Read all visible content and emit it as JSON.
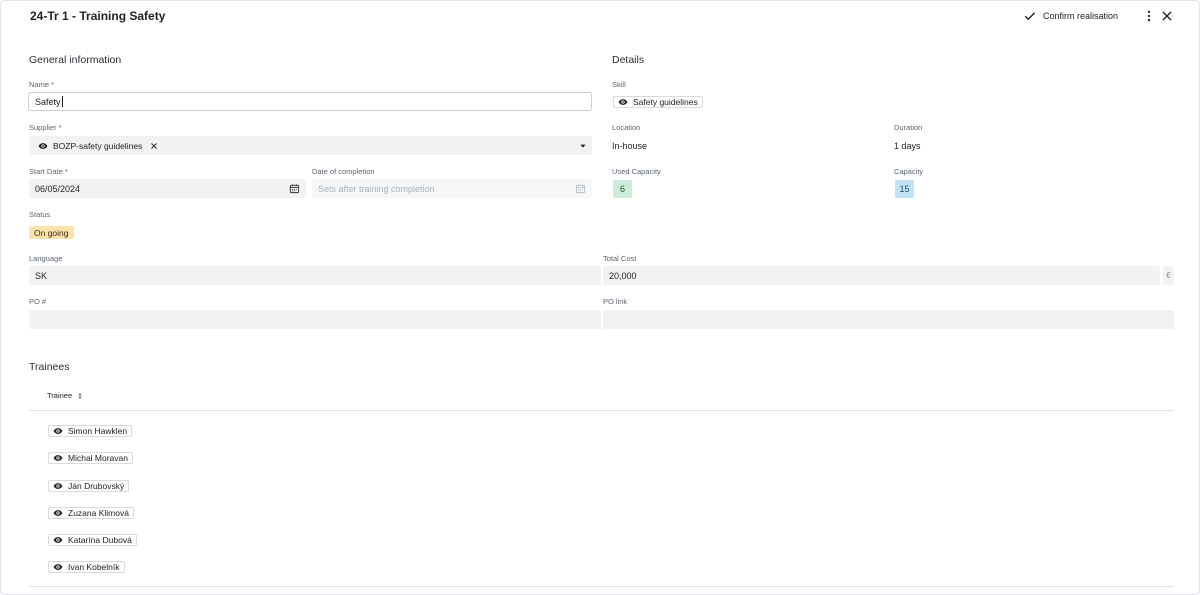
{
  "header": {
    "title": "24-Tr 1 - Training Safety",
    "confirm_label": "Confirm realisation"
  },
  "general": {
    "section_title": "General information",
    "name_label": "Name *",
    "name_value": "Safety",
    "supplier_label": "Supplier *",
    "supplier_value": "BOZP-safety guidelines",
    "start_date_label": "Start Date *",
    "start_date_value": "06/05/2024",
    "completion_label": "Date of completion",
    "completion_placeholder": "Sets after training completion",
    "status_label": "Status",
    "status_value": "On going",
    "language_label": "Language",
    "language_value": "SK",
    "po_label": "PO #",
    "po_value": ""
  },
  "details": {
    "section_title": "Details",
    "skill_label": "Skill",
    "skill_value": "Safety guidelines",
    "location_label": "Location",
    "location_value": "In-house",
    "duration_label": "Duration",
    "duration_value": "1 days",
    "used_capacity_label": "Used Capacity",
    "used_capacity_value": "6",
    "capacity_label": "Capacity",
    "capacity_value": "15",
    "total_cost_label": "Total Cost",
    "total_cost_value": "20,000",
    "currency": "€",
    "po_link_label": "PO link",
    "po_link_value": ""
  },
  "trainees": {
    "section_title": "Trainees",
    "column_header": "Trainee",
    "items": [
      "Simon Hawklen",
      "Michal Moravan",
      "Ján Drubovský",
      "Zuzana Klimová",
      "Katarína Dubová",
      "Ivan Kobelník"
    ]
  },
  "colors": {
    "status_badge": "#fbe3ad",
    "used_capacity_badge": "#cdebd9",
    "capacity_badge": "#c2e3f6",
    "field_fill": "#f0f2f3"
  },
  "icons": {
    "confirm": "check-icon",
    "more": "more-vertical-icon",
    "close": "close-icon",
    "view": "eye-icon",
    "remove": "x-icon",
    "dropdown": "caret-down-icon",
    "calendar": "calendar-icon",
    "sort": "sort-icon"
  }
}
